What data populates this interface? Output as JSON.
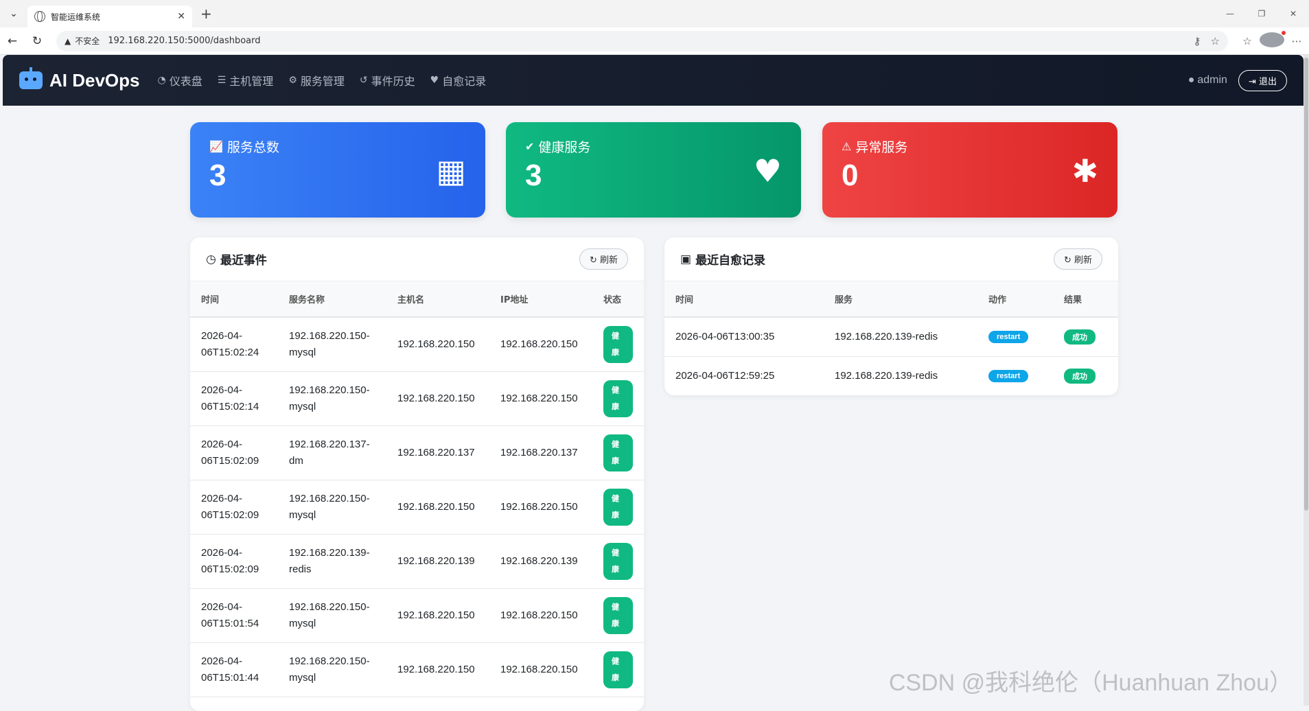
{
  "browser": {
    "tab_title": "智能运维系统",
    "security_label": "不安全",
    "url": "192.168.220.150:5000/dashboard"
  },
  "nav": {
    "brand": "AI DevOps",
    "items": [
      {
        "icon": "dashboard-icon",
        "label": "仪表盘"
      },
      {
        "icon": "server-icon",
        "label": "主机管理"
      },
      {
        "icon": "cogs-icon",
        "label": "服务管理"
      },
      {
        "icon": "history-icon",
        "label": "事件历史"
      },
      {
        "icon": "heartbeat-icon",
        "label": "自愈记录"
      }
    ],
    "user": "admin",
    "logout": "退出"
  },
  "stats": [
    {
      "label": "服务总数",
      "value": "3",
      "icon": "cubes-icon",
      "color": "#2563eb"
    },
    {
      "label": "健康服务",
      "value": "3",
      "icon": "heartbeat-icon",
      "color": "#059669"
    },
    {
      "label": "异常服务",
      "value": "0",
      "icon": "bug-icon",
      "color": "#dc2626"
    }
  ],
  "events": {
    "title": "最近事件",
    "refresh": "刷新",
    "headers": [
      "时间",
      "服务名称",
      "主机名",
      "IP地址",
      "状态"
    ],
    "rows": [
      {
        "time1": "2026-04-",
        "time2": "06T15:02:24",
        "svc1": "192.168.220.150-",
        "svc2": "mysql",
        "host": "192.168.220.150",
        "ip": "192.168.220.150",
        "status": "健康"
      },
      {
        "time1": "2026-04-",
        "time2": "06T15:02:14",
        "svc1": "192.168.220.150-",
        "svc2": "mysql",
        "host": "192.168.220.150",
        "ip": "192.168.220.150",
        "status": "健康"
      },
      {
        "time1": "2026-04-",
        "time2": "06T15:02:09",
        "svc1": "192.168.220.137-",
        "svc2": "dm",
        "host": "192.168.220.137",
        "ip": "192.168.220.137",
        "status": "健康"
      },
      {
        "time1": "2026-04-",
        "time2": "06T15:02:09",
        "svc1": "192.168.220.150-",
        "svc2": "mysql",
        "host": "192.168.220.150",
        "ip": "192.168.220.150",
        "status": "健康"
      },
      {
        "time1": "2026-04-",
        "time2": "06T15:02:09",
        "svc1": "192.168.220.139-",
        "svc2": "redis",
        "host": "192.168.220.139",
        "ip": "192.168.220.139",
        "status": "健康"
      },
      {
        "time1": "2026-04-",
        "time2": "06T15:01:54",
        "svc1": "192.168.220.150-",
        "svc2": "mysql",
        "host": "192.168.220.150",
        "ip": "192.168.220.150",
        "status": "健康"
      },
      {
        "time1": "2026-04-",
        "time2": "06T15:01:44",
        "svc1": "192.168.220.150-",
        "svc2": "mysql",
        "host": "192.168.220.150",
        "ip": "192.168.220.150",
        "status": "健康"
      }
    ]
  },
  "heal": {
    "title": "最近自愈记录",
    "refresh": "刷新",
    "headers": [
      "时间",
      "服务",
      "动作",
      "结果"
    ],
    "rows": [
      {
        "time": "2026-04-06T13:00:35",
        "service": "192.168.220.139-redis",
        "action": "restart",
        "result": "成功"
      },
      {
        "time": "2026-04-06T12:59:25",
        "service": "192.168.220.139-redis",
        "action": "restart",
        "result": "成功"
      }
    ]
  },
  "watermark": "CSDN @我科绝伦（Huanhuan Zhou）"
}
